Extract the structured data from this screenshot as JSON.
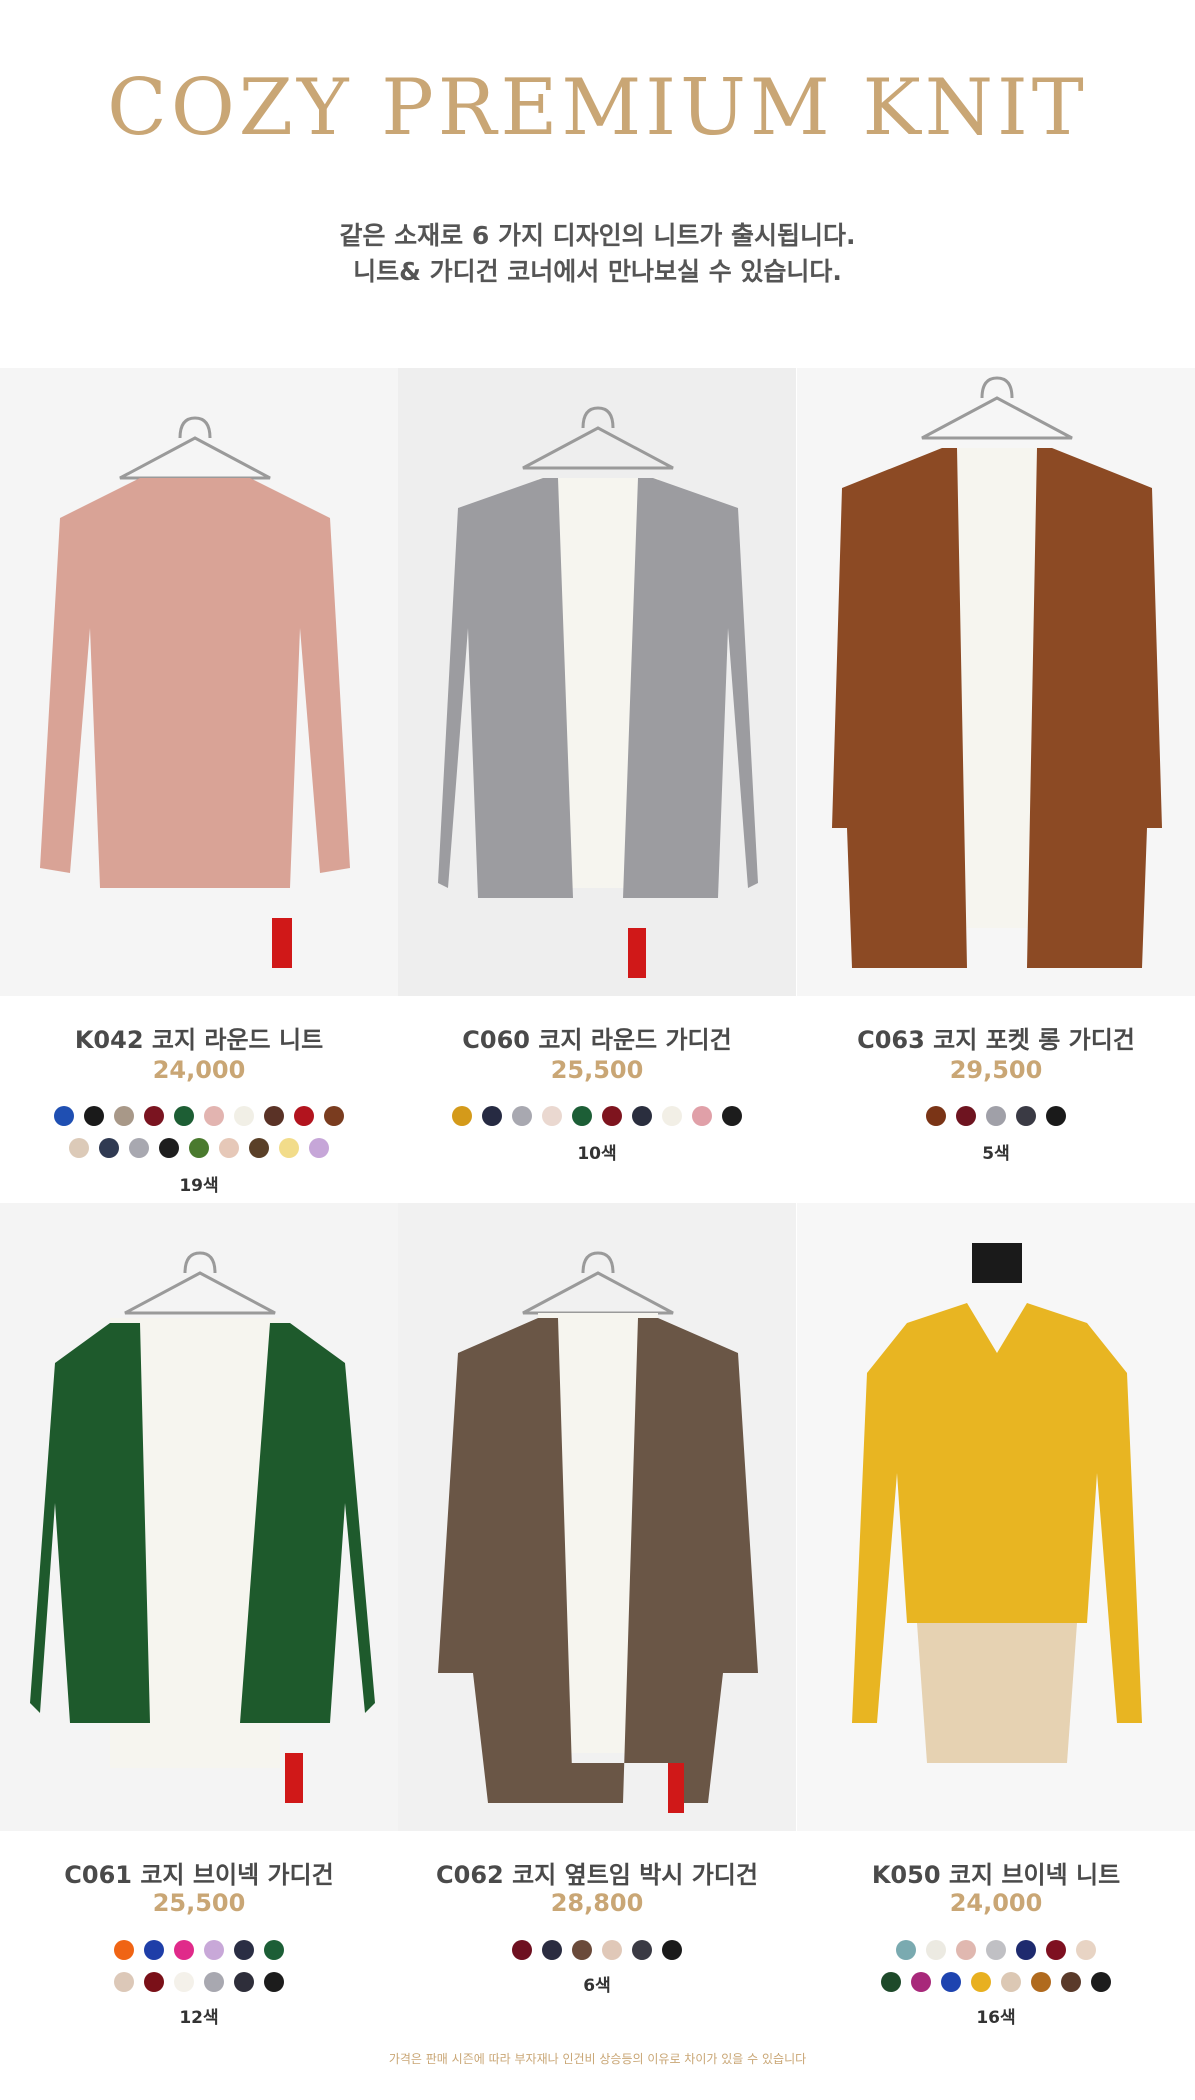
{
  "header": {
    "title": "COZY PREMIUM KNIT",
    "line1": "같은 소재로  6 가지 디자인의 니트가 출시됩니다.",
    "line2": "니트& 가디건 코너에서 만나보실 수 있습니다."
  },
  "products": [
    {
      "name": "K042 코지 라운드 니트",
      "price": "24,000",
      "count": "19색",
      "garment_color": "#d9a396",
      "swatches": [
        [
          "#1f4fb2",
          "#1a1a1a",
          "#a89888",
          "#7a1420",
          "#1d5e34",
          "#e2b4b0",
          "#f1efe6",
          "#5a3226",
          "#b2141e",
          "#7a3c1f"
        ],
        [
          "#dccab8",
          "#303a52",
          "#a8a8b0",
          "#1e1e1e",
          "#4a7a2e",
          "#e6c8b8",
          "#5a4028",
          "#f2dc8a",
          "#c6a6d8"
        ]
      ]
    },
    {
      "name": "C060 코지 라운드 가디건",
      "price": "25,500",
      "count": "10색",
      "garment_color": "#9c9ca0",
      "swatches": [
        [
          "#d49a1a",
          "#262a42",
          "#a8a8b0",
          "#ead8d0",
          "#1c5e36",
          "#7e141e",
          "#2a2e3e",
          "#f2efe6",
          "#e0a0a8",
          "#1c1c1c"
        ]
      ]
    },
    {
      "name": "C063 코지 포켓 롱 가디건",
      "price": "29,500",
      "count": "5색",
      "garment_color": "#8c4a24",
      "swatches": [
        [
          "#7a3416",
          "#6e1420",
          "#a0a0a8",
          "#3a3a44",
          "#1a1a1a"
        ]
      ]
    },
    {
      "name": "C061 코지 브이넥 가디건",
      "price": "25,500",
      "count": "12색",
      "garment_color": "#1e5a2c",
      "swatches": [
        [
          "#f06414",
          "#1e3ea8",
          "#e02a8a",
          "#c8a8d8",
          "#2a2e44",
          "#1c5e36"
        ],
        [
          "#dcc8b8",
          "#7a1018",
          "#f4f1ea",
          "#a8a8b0",
          "#2e2e3a",
          "#1c1c1c"
        ]
      ]
    },
    {
      "name": "C062 코지 옆트임 박시 가디건",
      "price": "28,800",
      "count": "6색",
      "garment_color": "#6a5646",
      "swatches": [
        [
          "#6e1020",
          "#2a2c40",
          "#6a4a3a",
          "#e0c8b8",
          "#3a3a44",
          "#1a1a1a"
        ]
      ]
    },
    {
      "name": "K050 코지 브이넥 니트",
      "price": "24,000",
      "count": "16색",
      "garment_color": "#e8b522",
      "swatches": [
        [
          "#7aaab0",
          "#eceae2",
          "#e0b8b0",
          "#c0c0c4",
          "#1e2a6e",
          "#7e1020",
          "#e8d4c4"
        ],
        [
          "#1e4a2a",
          "#a8287a",
          "#1e44b0",
          "#e8b020",
          "#dcc8b4",
          "#b06a1e",
          "#5a3a2a",
          "#1c1c1c"
        ]
      ]
    }
  ],
  "footer": {
    "note": "가격은 판매 시즌에 따라 부자재나 인건비 상승등의 이유로 차이가 있을 수 있습니다"
  }
}
